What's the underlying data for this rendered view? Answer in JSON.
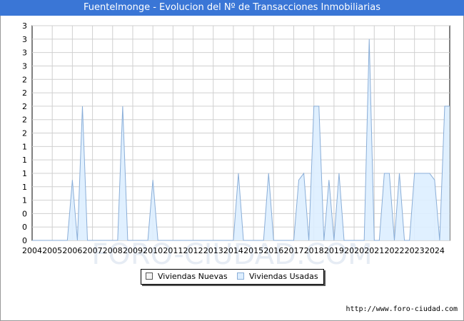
{
  "title": "Fuentelmonge - Evolucion del Nº de Transacciones Inmobiliarias",
  "source": "http://www.foro-ciudad.com",
  "colors": {
    "title_bg": "#3a76d6",
    "usadas_fill": "#ddeeff",
    "usadas_line": "#8aaed8",
    "nuevas_fill": "#f4f4f4",
    "grid": "#d0d0d0"
  },
  "legend": [
    {
      "label": "Viviendas Nuevas",
      "color": "#f4f4f4"
    },
    {
      "label": "Viviendas Usadas",
      "color": "#ddeeff"
    }
  ],
  "chart_data": {
    "type": "area",
    "title": "Fuentelmonge - Evolucion del Nº de Transacciones Inmobiliarias",
    "xlabel": "",
    "ylabel": "",
    "x_tick_labels": [
      "2004",
      "2005",
      "2006",
      "2007",
      "2008",
      "2009",
      "2010",
      "2011",
      "2012",
      "2013",
      "2014",
      "2015",
      "2016",
      "2017",
      "2018",
      "2019",
      "2020",
      "2021",
      "2022",
      "2023",
      "2024"
    ],
    "y_tick_labels": [
      "0",
      "0",
      "0",
      "1",
      "1",
      "1",
      "1",
      "1",
      "2",
      "2",
      "2",
      "2",
      "2",
      "3",
      "3",
      "3",
      "3"
    ],
    "y_tick_values": [
      0,
      0.2,
      0.4,
      0.6,
      0.8,
      1.0,
      1.2,
      1.4,
      1.6,
      1.8,
      2.0,
      2.2,
      2.4,
      2.6,
      2.8,
      3.0,
      3.2
    ],
    "ylim": [
      0,
      3.2
    ],
    "xlim": [
      2004,
      2024.75
    ],
    "grid": true,
    "legend_position": "bottom",
    "series": [
      {
        "name": "Viviendas Nuevas",
        "x": [
          2004,
          2024.75
        ],
        "values": [
          0,
          0
        ]
      },
      {
        "name": "Viviendas Usadas",
        "x": [
          2004,
          2005.75,
          2006,
          2006.25,
          2006.5,
          2006.75,
          2007,
          2007.25,
          2008.25,
          2008.5,
          2008.75,
          2009.75,
          2010,
          2010.25,
          2014,
          2014.25,
          2014.5,
          2015.5,
          2015.75,
          2016,
          2017,
          2017.25,
          2017.5,
          2017.75,
          2018,
          2018.25,
          2018.5,
          2018.75,
          2019,
          2019.25,
          2019.5,
          2019.75,
          2020,
          2020.5,
          2020.75,
          2021,
          2021.25,
          2021.5,
          2021.75,
          2022,
          2022.25,
          2022.5,
          2022.75,
          2023,
          2023,
          2023.25,
          2023.5,
          2023.75,
          2024,
          2024.25,
          2024.5,
          2024.75
        ],
        "values": [
          0,
          0,
          0.9,
          0,
          2.0,
          0,
          0,
          0,
          0,
          2.0,
          0,
          0,
          0.9,
          0,
          0,
          1.0,
          0,
          0,
          1.0,
          0,
          0,
          0.9,
          1.0,
          0,
          2.0,
          2.0,
          0,
          0.9,
          0,
          1.0,
          0,
          0,
          0,
          0,
          3.0,
          0,
          0,
          1.0,
          1.0,
          0,
          1.0,
          0,
          0,
          1.0,
          1.0,
          1.0,
          1.0,
          1.0,
          0.9,
          0,
          2.0,
          2.0
        ]
      }
    ]
  }
}
